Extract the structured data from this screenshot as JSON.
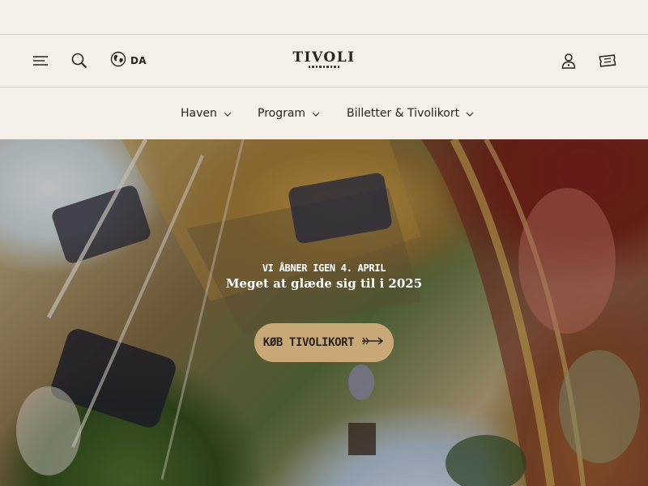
{
  "header": {
    "language": "DA",
    "logo": "TIVOLI"
  },
  "nav": {
    "items": [
      {
        "label": "Haven"
      },
      {
        "label": "Program"
      },
      {
        "label": "Billetter & Tivolikort"
      }
    ]
  },
  "hero": {
    "kicker": "VI ÅBNER IGEN 4. APRIL",
    "title": "Meget at glæde sig til i 2025",
    "cta_label": "KØB TIVOLIKORT"
  },
  "icons": {
    "menu": "menu-icon",
    "search": "search-icon",
    "language": "globe-icon",
    "account": "user-icon",
    "tickets": "ticket-icon",
    "dropdown": "chevron-down-icon",
    "cta": "arrow-right-icon"
  },
  "colors": {
    "background": "#f4efe8",
    "text": "#2a2320",
    "cta_background": "#c8a877",
    "divider": "#d9d1c6"
  }
}
